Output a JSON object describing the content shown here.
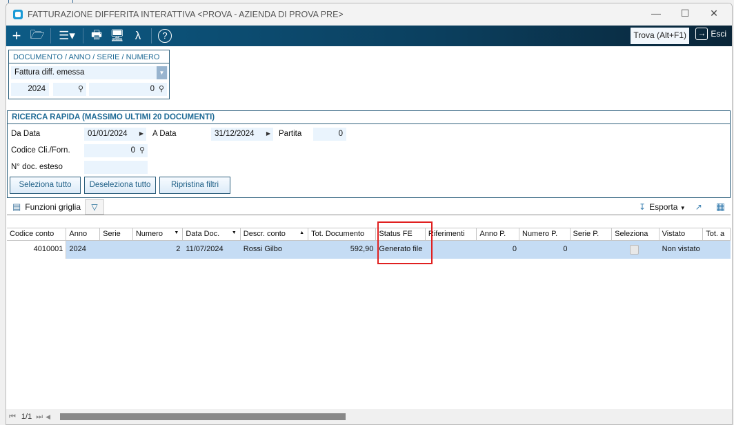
{
  "window": {
    "title": "FATTURAZIONE DIFFERITA INTERATTIVA <PROVA - AZIENDA DI PROVA PRE>"
  },
  "toolbar": {
    "find_label": "Trova (Alt+F1)",
    "exit_label": "Esci"
  },
  "document": {
    "header": "DOCUMENTO / ANNO / SERIE / NUMERO",
    "type": "Fattura diff. emessa",
    "year": "2024",
    "series": "",
    "number": "0"
  },
  "search": {
    "header": "RICERCA RAPIDA (MASSIMO ULTIMI 20 DOCUMENTI)",
    "from_date_label": "Da Data",
    "from_date": "01/01/2024",
    "to_date_label": "A Data",
    "to_date": "31/12/2024",
    "partita_label": "Partita",
    "partita": "0",
    "code_label": "Codice Cli./Forn.",
    "code": "0",
    "docnum_label": "N° doc. esteso",
    "docnum": "",
    "select_all": "Seleziona tutto",
    "deselect_all": "Deseleziona tutto",
    "reset_filters": "Ripristina filtri"
  },
  "gridbar": {
    "functions_label": "Funzioni griglia",
    "export_label": "Esporta"
  },
  "grid": {
    "columns": [
      "Codice conto",
      "Anno",
      "Serie",
      "Numero",
      "Data Doc.",
      "Descr. conto",
      "Tot. Documento",
      "Status FE",
      "Riferimenti",
      "Anno P.",
      "Numero P.",
      "Serie P.",
      "Seleziona",
      "Vistato",
      "Tot. a"
    ],
    "rows": [
      [
        "4010001",
        "2024",
        "",
        "2",
        "11/07/2024",
        "Rossi Gilbo",
        "592,90",
        "Generato file",
        "",
        "0",
        "0",
        "",
        "",
        "Non vistato",
        ""
      ]
    ]
  },
  "footer": {
    "page": "1/1"
  }
}
